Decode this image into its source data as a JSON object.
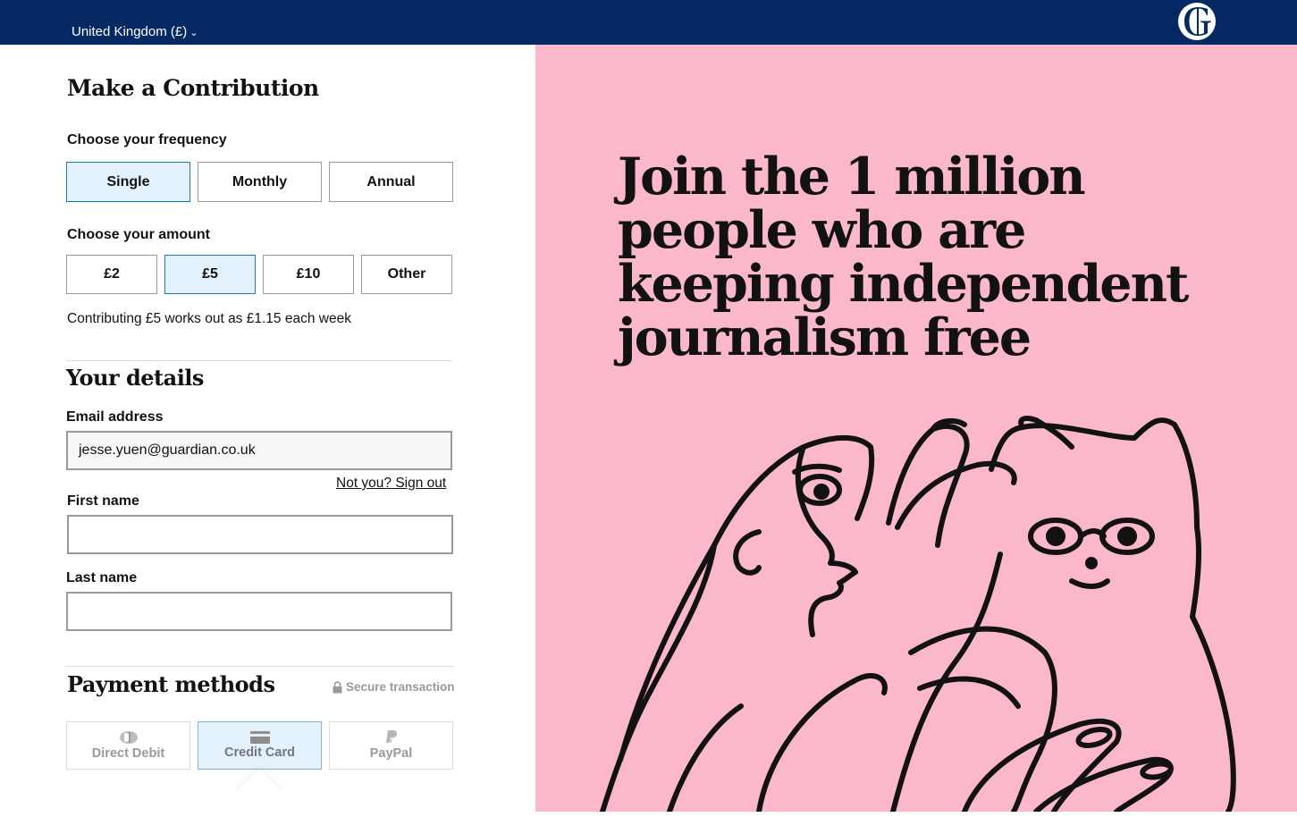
{
  "header": {
    "country_selector": "United Kingdom (£)",
    "logo": "guardian-g-logo",
    "background_color": "#052962"
  },
  "form": {
    "title": "Make a Contribution",
    "frequency": {
      "label": "Choose your frequency",
      "options": [
        "Single",
        "Monthly",
        "Annual"
      ],
      "selected": "Single"
    },
    "amount": {
      "label": "Choose your amount",
      "options": [
        "£2",
        "£5",
        "£10",
        "Other"
      ],
      "selected": "£5",
      "note": "Contributing £5 works out as £1.15 each week"
    },
    "details": {
      "title": "Your details",
      "email_label": "Email address",
      "email_value": "jesse.yuen@guardian.co.uk",
      "signout_link": "Not you? Sign out",
      "first_name_label": "First name",
      "first_name_value": "",
      "last_name_label": "Last name",
      "last_name_value": ""
    },
    "payment": {
      "title": "Payment methods",
      "secure_label": "Secure transaction",
      "methods": [
        {
          "label": "Direct Debit",
          "icon": "direct-debit-icon"
        },
        {
          "label": "Credit Card",
          "icon": "credit-card-icon"
        },
        {
          "label": "PayPal",
          "icon": "paypal-icon"
        }
      ],
      "selected": "Credit Card"
    }
  },
  "hero": {
    "headline": "Join the 1 million people who are keeping independent journalism free",
    "background_color": "#fcb8cb",
    "illustration": "person-and-cat-line-drawing"
  },
  "colors": {
    "brand_navy": "#052962",
    "selected_fill": "#e3f1fc",
    "selected_border": "#197caa"
  }
}
